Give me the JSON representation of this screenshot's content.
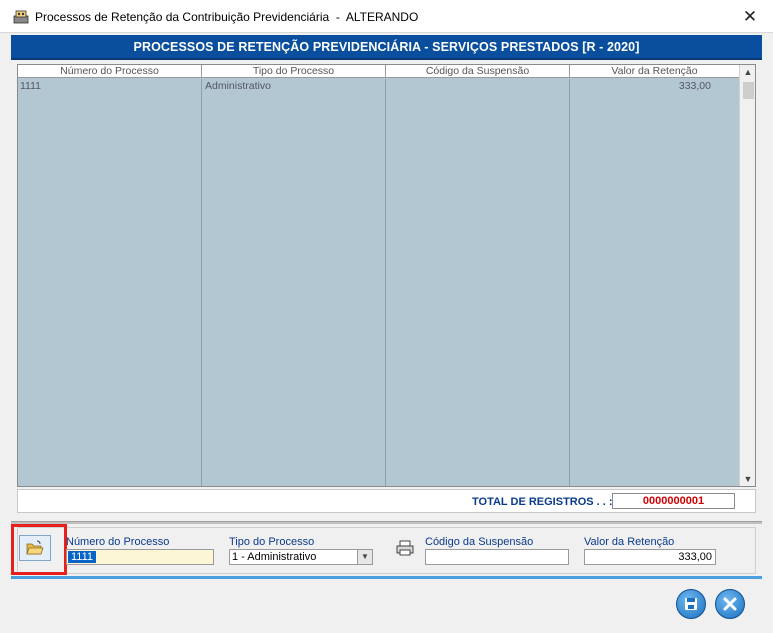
{
  "window": {
    "title": "Processos de Retenção da Contribuição Previdenciária  -  ALTERANDO",
    "close_label": "✕"
  },
  "header": {
    "title": "PROCESSOS DE RETENÇÃO PREVIDENCIÁRIA - SERVIÇOS PRESTADOS [R - 2020]"
  },
  "grid": {
    "columns": [
      "Número do Processo",
      "Tipo do Processo",
      "Código da Suspensão",
      "Valor da Retenção"
    ],
    "rows": [
      [
        "1111",
        "Administrativo",
        "",
        "333,00"
      ]
    ]
  },
  "total": {
    "label": "TOTAL DE REGISTROS . . :",
    "value": "0000000001"
  },
  "form": {
    "numero_label": "Número do Processo",
    "numero_value": "1111",
    "tipo_label": "Tipo do Processo",
    "tipo_value": "1 - Administrativo",
    "suspensao_label": "Código da Suspensão",
    "suspensao_value": "",
    "valor_label": "Valor da Retenção",
    "valor_value": "333,00"
  },
  "colors": {
    "header_bg": "#0a4f9e",
    "grid_bg": "#b2c7d2",
    "total_value": "#d00000",
    "highlight": "#e8201c"
  },
  "icons": {
    "app": "app-icon",
    "open": "folder-open-icon",
    "print": "printer-icon",
    "save": "save-icon",
    "cancel": "cancel-icon"
  }
}
